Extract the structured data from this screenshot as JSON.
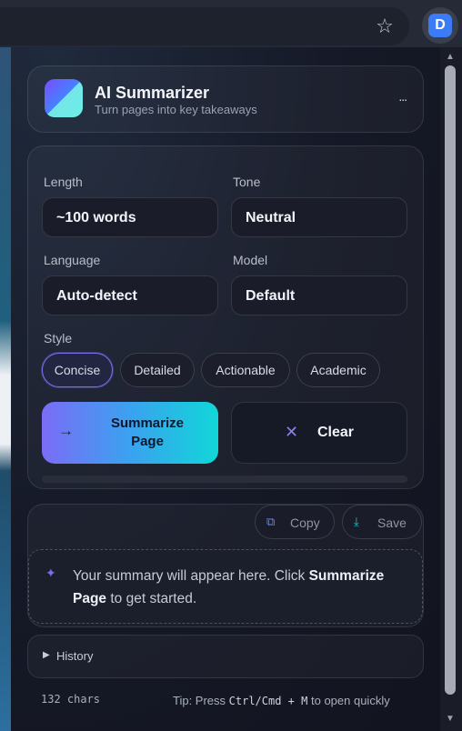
{
  "browser": {
    "star_icon": "star-outline-icon",
    "extension_badge": "D"
  },
  "header": {
    "title": "AI Summarizer",
    "subtitle": "Turn pages into key takeaways",
    "more": "..."
  },
  "settings": {
    "length": {
      "label": "Length",
      "value": "~100 words"
    },
    "tone": {
      "label": "Tone",
      "value": "Neutral"
    },
    "language": {
      "label": "Language",
      "value": "Auto-detect"
    },
    "model": {
      "label": "Model",
      "value": "Default"
    },
    "style": {
      "label": "Style",
      "options": [
        "Concise",
        "Detailed",
        "Actionable",
        "Academic"
      ],
      "selected": "Concise"
    }
  },
  "actions": {
    "summarize_line1": "Summarize",
    "summarize_line2": "Page",
    "clear": "Clear"
  },
  "output": {
    "copy": "Copy",
    "save": "Save",
    "placeholder_pre": "Your summary will appear here. Click ",
    "placeholder_bold": "Summarize Page",
    "placeholder_post": " to get started."
  },
  "history": {
    "label": "History"
  },
  "footer": {
    "chars": "132 chars",
    "tip_pre": "Tip: Press ",
    "tip_kbd1": "Ctrl/Cmd",
    "tip_plus": " + ",
    "tip_kbd2": "M",
    "tip_post": " to open quickly"
  },
  "colors": {
    "accent": "#7b6cf6",
    "accent_end": "#11d6d8"
  }
}
